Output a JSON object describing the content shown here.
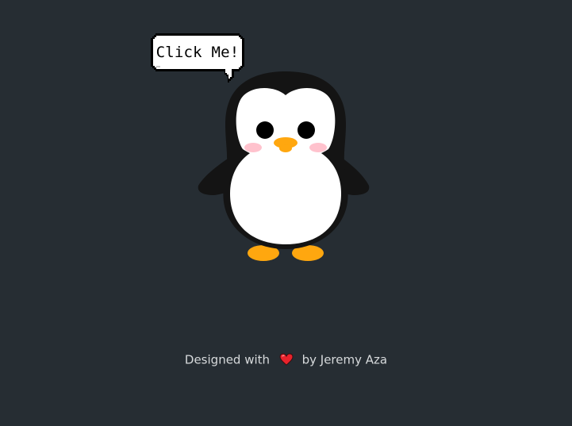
{
  "bubble": {
    "label": "Click Me!"
  },
  "penguin": {
    "colors": {
      "body": "#141414",
      "belly": "#ffffff",
      "beak": "#ffa70f",
      "feet": "#ffa70f",
      "cheeks": "#ffc2cd",
      "eyes": "#000000"
    }
  },
  "footer": {
    "prefix": "Designed with",
    "heart_icon": "heart-icon",
    "suffix": "by Jeremy Aza"
  },
  "colors": {
    "background": "#262d33",
    "footer_text": "#d7dadc",
    "heart": "#e8232c"
  }
}
